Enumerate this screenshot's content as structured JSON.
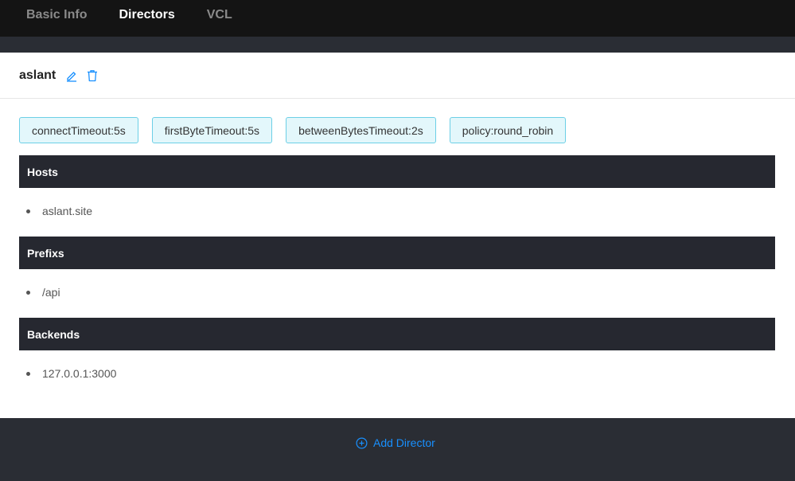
{
  "nav": {
    "tabs": [
      {
        "label": "Basic Info",
        "active": false
      },
      {
        "label": "Directors",
        "active": true
      },
      {
        "label": "VCL",
        "active": false
      }
    ]
  },
  "director": {
    "name": "aslant",
    "actions": {
      "edit_icon": "edit-icon",
      "delete_icon": "delete-icon"
    },
    "tags": [
      "connectTimeout:5s",
      "firstByteTimeout:5s",
      "betweenBytesTimeout:2s",
      "policy:round_robin"
    ],
    "sections": {
      "hosts": {
        "title": "Hosts",
        "items": [
          "aslant.site"
        ]
      },
      "prefixs": {
        "title": "Prefixs",
        "items": [
          "/api"
        ]
      },
      "backends": {
        "title": "Backends",
        "items": [
          "127.0.0.1:3000"
        ]
      }
    }
  },
  "footer": {
    "add_label": "Add Director",
    "add_icon": "plus-circle-icon"
  },
  "colors": {
    "accent": "#1890ff",
    "tag_border": "#6ccfe6",
    "tag_bg": "#e3f7fb",
    "section_bg": "#262830",
    "nav_bg": "#141414",
    "page_bg": "#2a2d34"
  }
}
